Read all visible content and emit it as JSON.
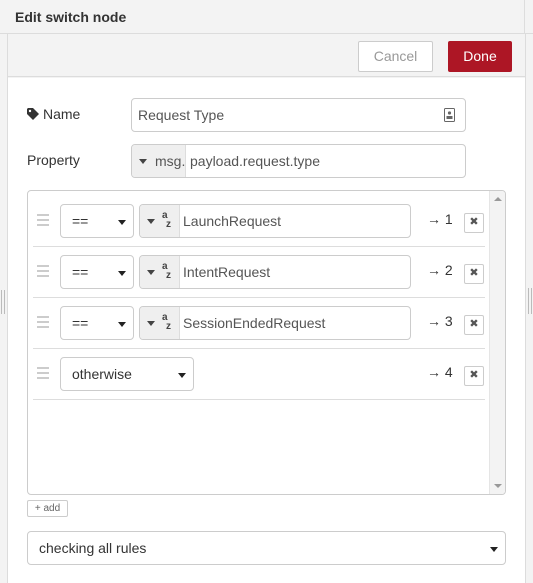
{
  "dialog": {
    "title": "Edit switch node",
    "cancel_label": "Cancel",
    "done_label": "Done"
  },
  "form": {
    "name_label": "Name",
    "name_value": "Request Type",
    "property_label": "Property",
    "property_prefix": "msg.",
    "property_value": "payload.request.type"
  },
  "rules": [
    {
      "operator": "==",
      "value": "LaunchRequest",
      "output": "→ 1"
    },
    {
      "operator": "==",
      "value": "IntentRequest",
      "output": "→ 2"
    },
    {
      "operator": "==",
      "value": "SessionEndedRequest",
      "output": "→ 3"
    },
    {
      "operator": "otherwise",
      "value": "",
      "output": "→ 4"
    }
  ],
  "value_type_icon": {
    "top": "a",
    "bottom": "z"
  },
  "remove_glyph": "✖",
  "add_label": "add",
  "add_glyph": "+",
  "checking_value": "checking all rules",
  "colors": {
    "done_button": "#ad1625",
    "panel": "#f3f3f3"
  },
  "icons": [
    "tag-icon",
    "card-icon",
    "caret-down-icon",
    "string-type-icon",
    "drag-handle-icon",
    "remove-icon",
    "plus-icon"
  ]
}
